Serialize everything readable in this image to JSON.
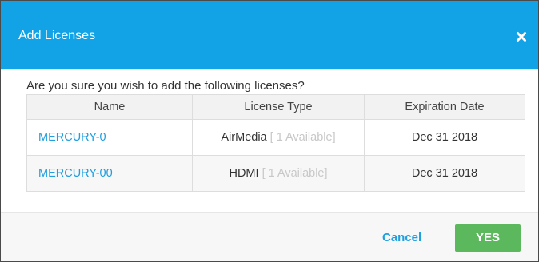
{
  "dialog": {
    "title": "Add Licenses",
    "question": "Are you sure you wish to add the following licenses?",
    "colors": {
      "header_bg": "#12a2e6",
      "link": "#1e9fe0",
      "confirm_bg": "#5cb85c"
    },
    "close_icon": "close-icon"
  },
  "table": {
    "headers": [
      "Name",
      "License Type",
      "Expiration Date"
    ],
    "rows": [
      {
        "name": "MERCURY-0",
        "license_type": "AirMedia",
        "available": "[ 1 Available]",
        "expiration": "Dec 31 2018"
      },
      {
        "name": "MERCURY-00",
        "license_type": "HDMI",
        "available": "[ 1 Available]",
        "expiration": "Dec 31 2018"
      }
    ]
  },
  "footer": {
    "cancel_label": "Cancel",
    "confirm_label": "YES"
  }
}
